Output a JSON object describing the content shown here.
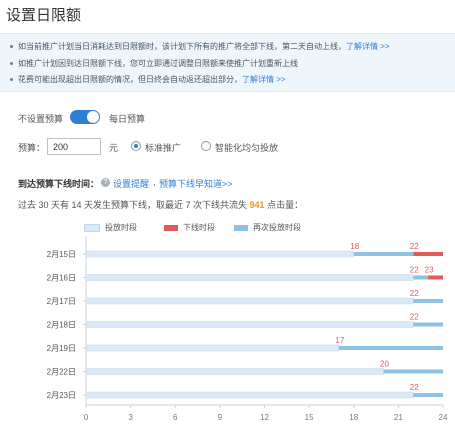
{
  "page": {
    "title": "设置日限额"
  },
  "notice": {
    "lines": [
      "如当前推广计划当日消耗达到日限额时，该计划下所有的推广将全部下线，第二天自动上线，",
      "如推广计划因到达日限额下线，您可立即通过调整日限额来使推广计划重新上线",
      "花费可能出现超出日限额的情况，但日终会自动返还超出部分，"
    ],
    "learn_more": "了解详情 >>"
  },
  "budget_mode": {
    "off_label": "不设置预算",
    "on_label": "每日预算",
    "enabled": true
  },
  "budget": {
    "label": "预算：",
    "value": "200",
    "unit": "元",
    "options": [
      "标准推广",
      "智能化均匀投放"
    ],
    "selected": "标准推广"
  },
  "offline_time": {
    "label": "到达预算下线时间：",
    "set_reminder": "设置提醒",
    "learn_link": "预算下线早知道>>",
    "summary_pre": "过去 30 天有 14 天发生预算下线，取最近 7 次下线共流失",
    "lost_clicks": "941",
    "summary_post": "点击量："
  },
  "colors": {
    "accent": "#2f7ed8",
    "serving": "#dbe9f6",
    "offline": "#e05a5a",
    "resumed": "#8fc1e3"
  },
  "chart_data": {
    "type": "gantt",
    "legend": [
      "投放时段",
      "下线时段",
      "再次投放时段"
    ],
    "x_ticks": [
      0,
      3,
      6,
      9,
      12,
      15,
      18,
      21,
      24
    ],
    "xlim": [
      0,
      24
    ],
    "rows": [
      {
        "date": "2月15日",
        "marks": [
          "18",
          "22"
        ],
        "segments": [
          {
            "kind": "serving",
            "from": 0,
            "to": 18
          },
          {
            "kind": "resumed",
            "from": 18,
            "to": 22
          },
          {
            "kind": "offline",
            "from": 22,
            "to": 24
          }
        ]
      },
      {
        "date": "2月16日",
        "marks": [
          "22",
          "23"
        ],
        "segments": [
          {
            "kind": "serving",
            "from": 0,
            "to": 22
          },
          {
            "kind": "resumed",
            "from": 22,
            "to": 23
          },
          {
            "kind": "offline",
            "from": 23,
            "to": 24
          }
        ]
      },
      {
        "date": "2月17日",
        "marks": [
          "22"
        ],
        "segments": [
          {
            "kind": "serving",
            "from": 0,
            "to": 22
          },
          {
            "kind": "resumed",
            "from": 22,
            "to": 24
          }
        ]
      },
      {
        "date": "2月18日",
        "marks": [
          "22"
        ],
        "segments": [
          {
            "kind": "serving",
            "from": 0,
            "to": 22
          },
          {
            "kind": "resumed",
            "from": 22,
            "to": 24
          }
        ]
      },
      {
        "date": "2月19日",
        "marks": [
          "17"
        ],
        "segments": [
          {
            "kind": "serving",
            "from": 0,
            "to": 17
          },
          {
            "kind": "resumed",
            "from": 17,
            "to": 24
          }
        ]
      },
      {
        "date": "2月22日",
        "marks": [
          "20"
        ],
        "segments": [
          {
            "kind": "serving",
            "from": 0,
            "to": 20
          },
          {
            "kind": "resumed",
            "from": 20,
            "to": 24
          }
        ]
      },
      {
        "date": "2月23日",
        "marks": [
          "22"
        ],
        "segments": [
          {
            "kind": "serving",
            "from": 0,
            "to": 22
          },
          {
            "kind": "resumed",
            "from": 22,
            "to": 24
          }
        ]
      }
    ]
  }
}
